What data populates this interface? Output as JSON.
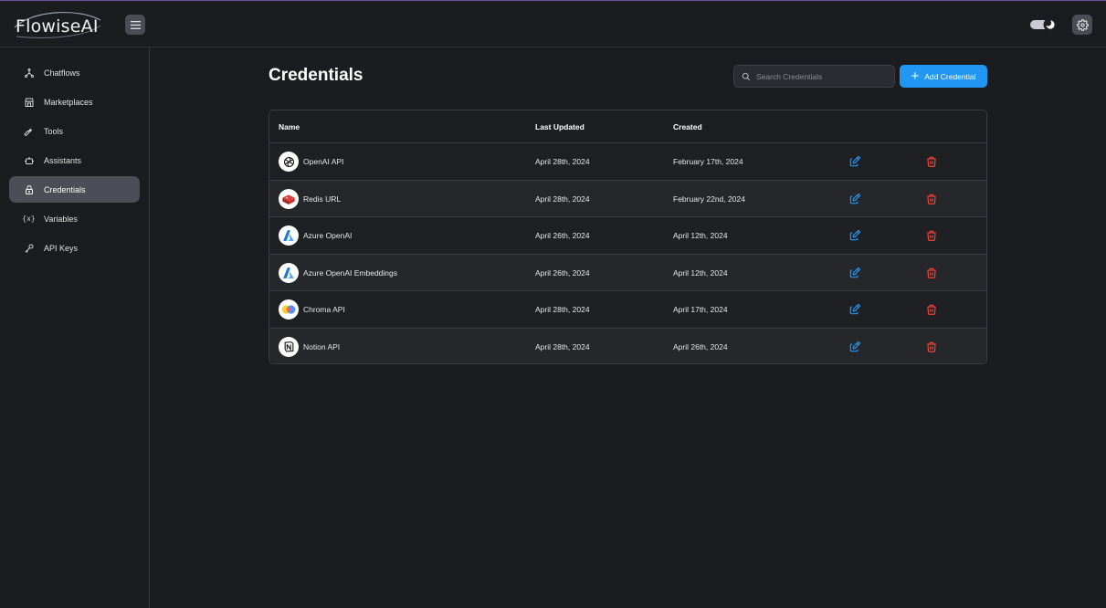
{
  "header": {
    "logo_text": "FlowiseAI"
  },
  "sidebar": {
    "items": [
      {
        "label": "Chatflows",
        "icon": "hierarchy-icon",
        "active": false
      },
      {
        "label": "Marketplaces",
        "icon": "store-icon",
        "active": false
      },
      {
        "label": "Tools",
        "icon": "tool-icon",
        "active": false
      },
      {
        "label": "Assistants",
        "icon": "robot-icon",
        "active": false
      },
      {
        "label": "Credentials",
        "icon": "lock-icon",
        "active": true
      },
      {
        "label": "Variables",
        "icon": "variable-icon",
        "active": false
      },
      {
        "label": "API Keys",
        "icon": "key-icon",
        "active": false
      }
    ]
  },
  "main": {
    "title": "Credentials",
    "search": {
      "placeholder": "Search Credentials",
      "value": ""
    },
    "add_button_label": "Add Credential",
    "table": {
      "columns": [
        "Name",
        "Last Updated",
        "Created"
      ],
      "rows": [
        {
          "name": "OpenAI API",
          "last_updated": "April 28th, 2024",
          "created": "February 17th, 2024",
          "icon": "openai-icon"
        },
        {
          "name": "Redis URL",
          "last_updated": "April 28th, 2024",
          "created": "February 22nd, 2024",
          "icon": "redis-icon"
        },
        {
          "name": "Azure OpenAI",
          "last_updated": "April 26th, 2024",
          "created": "April 12th, 2024",
          "icon": "azure-icon"
        },
        {
          "name": "Azure OpenAI Embeddings",
          "last_updated": "April 26th, 2024",
          "created": "April 12th, 2024",
          "icon": "azure-icon"
        },
        {
          "name": "Chroma API",
          "last_updated": "April 28th, 2024",
          "created": "April 17th, 2024",
          "icon": "chroma-icon"
        },
        {
          "name": "Notion API",
          "last_updated": "April 28th, 2024",
          "created": "April 26th, 2024",
          "icon": "notion-icon"
        }
      ]
    }
  },
  "colors": {
    "accent": "#2196f3",
    "edit": "#2196f3",
    "delete": "#f44336",
    "background": "#1b1c20",
    "active_nav": "#4b4e57"
  }
}
